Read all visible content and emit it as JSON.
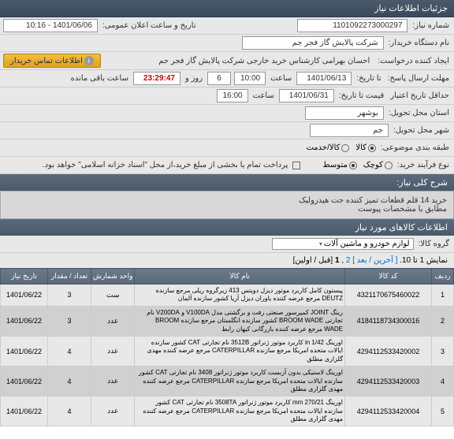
{
  "header": {
    "title": "جزئیات اطلاعات نیاز"
  },
  "fields": {
    "need_number_label": "شماره نیاز:",
    "need_number": "1101092273000297",
    "announce_label": "تاریخ و ساعت اعلان عمومی:",
    "announce_value": "1401/06/06 - 10:16",
    "buyer_org_label": "نام دستگاه خریدار:",
    "buyer_org": "شرکت پالایش گاز فجر جم",
    "requester_label": "ایجاد کننده درخواست:",
    "requester": "احسان بهرامی کارشناس خرید خارجی شرکت پالایش گاز فجر جم",
    "contact_btn": "اطلاعات تماس خریدار",
    "deadline_label": "مهلت ارسال پاسخ:",
    "deadline_sep": "تا تاریخ:",
    "deadline_date": "1401/06/13",
    "time_label": "ساعت",
    "deadline_time": "10:00",
    "days_count": "6",
    "days_label": "روز و",
    "countdown": "23:29:47",
    "remain_label": "ساعت باقی مانده",
    "validity_label": "حداقل تاریخ اعتبار",
    "validity_sep": "قیمت تا تاریخ:",
    "validity_date": "1401/06/31",
    "validity_time": "16:00",
    "province_label": "استان محل تحویل:",
    "province": "بوشهر",
    "city_label": "شهر محل تحویل:",
    "city": "جم",
    "category_label": "طبقه بندی موضوعی:",
    "cat_goods": "کالا",
    "cat_service": "کالا/خدمت",
    "purchase_type_label": "نوع فرآیند خرید:",
    "type_small": "کوچک",
    "type_medium": "متوسط",
    "payment_note": "پرداخت تمام یا بخشی از مبلغ خرید،از محل \"اسناد خزانه اسلامی\" خواهد بود."
  },
  "desc": {
    "title": "شرح کلی نیاز:",
    "line1": "خرید 14 قلم قطعات تمیز کننده جت هیدرولیک",
    "line2": "مطابق با مشخصات پیوست"
  },
  "items_section": {
    "title": "اطلاعات کالاهای مورد نیاز"
  },
  "group": {
    "label": "گروه کالا:",
    "value": "لوازم خودرو و ماشین آلات"
  },
  "pager": {
    "display": "نمایش 1 تا 10.",
    "last": "[ آخرین ",
    "next": "/ بعد ]",
    "page2": "2",
    "page1": "1",
    "prev": "[قبل /",
    "first": "اولین]"
  },
  "columns": {
    "row": "ردیف",
    "code": "کد کالا",
    "name": "نام کالا",
    "unit": "واحد شمارش",
    "qty": "تعداد / مقدار",
    "date": "تاریخ نیاز"
  },
  "rows": [
    {
      "n": "1",
      "code": "4321170675460022",
      "desc": "پیستون کامل کاربرد موتور دیزل دویتس 413 زیرگروه ریلی مرجع سازنده DEUTZ مرجع عرضه کننده یاوران دیزل آریا کشور سازنده آلمان",
      "unit": "ست",
      "qty": "3",
      "date": "1401/06/22"
    },
    {
      "n": "2",
      "code": "4184118734300016",
      "desc": "رینگ JOINT کمپرسور صنعتی رفت و برگشتی مدل V100DA و V200DA نام تجارتی BROOM WADE کشور سازنده انگلستان مرجع سازنده BROOM WADE مرجع عرضه کننده بازرگانی کیهان رابط",
      "unit": "عدد",
      "qty": "3",
      "date": "1401/06/22"
    },
    {
      "n": "3",
      "code": "4294112533420002",
      "desc": "اورینگ in 1/42 کاربرد موتور ژنراتور 3512B نام تجارتی CAT کشور سازنده ایالات متحده امریکا مرجع سازنده CATERPILLAR مرجع عرضه کننده مهدی گلزاری مطلق",
      "unit": "عدد",
      "qty": "4",
      "date": "1401/06/22"
    },
    {
      "n": "4",
      "code": "4294112533420003",
      "desc": "اورینگ لاستیکی بدون آزبست کاربرد موتور ژنراتور 3408 نام تجارتی CAT کشور سازنده ایالات متحده امریکا مرجع سازنده CATERPILLAR مرجع عرضه کننده مهدی گلزاری مطلق",
      "unit": "عدد",
      "qty": "4",
      "date": "1401/06/22"
    },
    {
      "n": "5",
      "code": "4294112533420004",
      "desc": "اورینگ mm 270/21 کاربرد موتور ژنراتور 3508TA نام تجارتی CAT کشور سازنده ایالات متحده امریکا مرجع سازنده CATERPILLAR مرجع عرضه کننده مهدی گلزاری مطلق",
      "unit": "عدد",
      "qty": "4",
      "date": "1401/06/22"
    }
  ]
}
